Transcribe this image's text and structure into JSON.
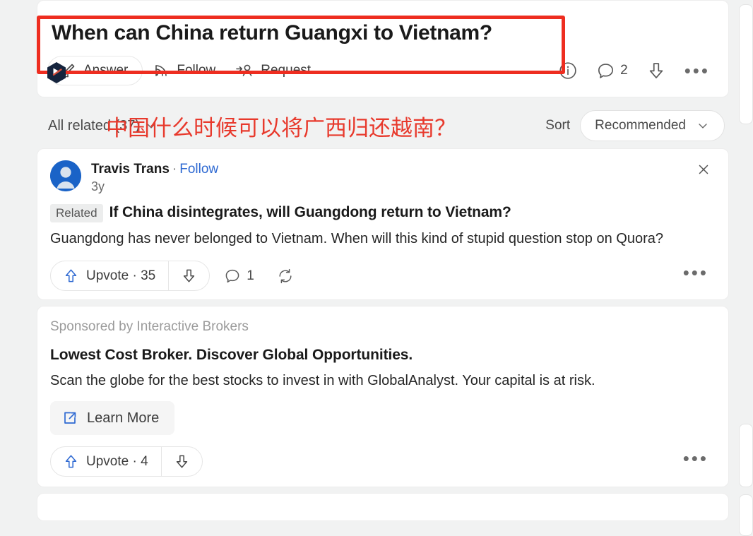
{
  "question": {
    "title": "When can China return Guangxi to Vietnam?",
    "actions": [
      {
        "id": "answer",
        "label": "Answer",
        "icon": "pencil-icon"
      },
      {
        "id": "follow",
        "label": "Follow",
        "icon": "rss-icon"
      },
      {
        "id": "request",
        "label": "Request",
        "icon": "person-arrow-icon"
      }
    ],
    "right_actions": {
      "info_icon": "info-circle-icon",
      "comment_icon": "comment-icon",
      "comment_count": "2",
      "downvote_icon": "downvote-icon",
      "more_icon": "more-dots-icon"
    }
  },
  "annotation": {
    "box_color": "#ee2d20",
    "translation": "中国什么时候可以将广西归还越南？"
  },
  "sortbar": {
    "all_related": "All related (37)",
    "chevron_icon": "chevron-down-icon",
    "sort_label": "Sort",
    "sort_value": "Recommended"
  },
  "answer": {
    "author": "Travis Trans",
    "separator": "·",
    "follow": "Follow",
    "time": "3y",
    "close_icon": "close-icon",
    "related_badge": "Related",
    "related_question": "If China disintegrates, will Guangdong return to Vietnam?",
    "body": "Guangdong has never belonged to Vietnam. When will this kind of stupid question stop on Quora?",
    "footer": {
      "upvote_label": "Upvote · 35",
      "upvote_icon": "upvote-arrow-icon",
      "downvote_icon": "downvote-arrow-icon",
      "comment_icon": "comment-icon",
      "comment_count": "1",
      "repost_icon": "repost-icon",
      "more_icon": "more-dots-icon"
    }
  },
  "ad": {
    "sponsored": "Sponsored by Interactive Brokers",
    "title": "Lowest Cost Broker. Discover Global Opportunities.",
    "description": "Scan the globe for the best stocks to invest in with GlobalAnalyst. Your capital is at risk.",
    "cta_label": "Learn More",
    "cta_icon": "external-link-icon",
    "footer": {
      "upvote_label": "Upvote · 4",
      "upvote_icon": "upvote-arrow-icon",
      "downvote_icon": "downvote-arrow-icon",
      "more_icon": "more-dots-icon"
    }
  },
  "colors": {
    "accent_blue": "#2e69d2",
    "upvote_blue": "#2e69d2",
    "annotation_red": "#ee2d20",
    "page_bg": "#f1f2f2",
    "card_bg": "#ffffff"
  }
}
